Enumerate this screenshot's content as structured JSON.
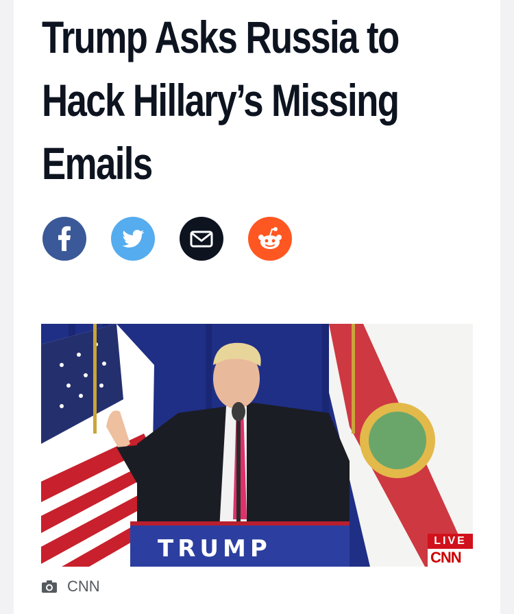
{
  "article": {
    "headline": "Trump Asks Russia to Hack Hillary’s Missing Emails"
  },
  "share": [
    {
      "name": "facebook",
      "icon": "facebook-icon",
      "color": "#3b5998"
    },
    {
      "name": "twitter",
      "icon": "twitter-icon",
      "color": "#55acee"
    },
    {
      "name": "email",
      "icon": "envelope-icon",
      "color": "#0d1420"
    },
    {
      "name": "reddit",
      "icon": "reddit-icon",
      "color": "#ff5722"
    }
  ],
  "hero_image": {
    "podium_text": "TRUMP",
    "live_label": "LIVE",
    "network_label": "CNN"
  },
  "caption": {
    "icon": "camera-icon",
    "credit": "CNN"
  }
}
